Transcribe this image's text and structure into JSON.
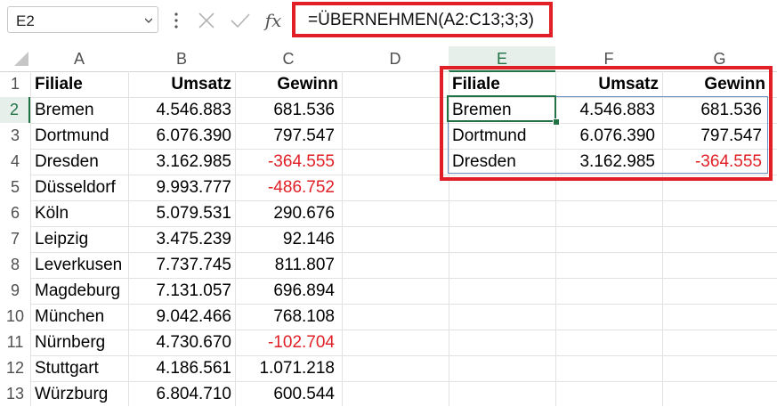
{
  "formula_bar": {
    "name_box": "E2",
    "fx_label": "fx",
    "formula": "=ÜBERNEHMEN(A2:C13;3;3)"
  },
  "columns": [
    "A",
    "B",
    "C",
    "D",
    "E",
    "F",
    "G"
  ],
  "rows": [
    "1",
    "2",
    "3",
    "4",
    "5",
    "6",
    "7",
    "8",
    "9",
    "10",
    "11",
    "12",
    "13"
  ],
  "source_table": {
    "headers": [
      "Filiale",
      "Umsatz",
      "Gewinn"
    ],
    "data": [
      [
        "Bremen",
        "4.546.883",
        "681.536"
      ],
      [
        "Dortmund",
        "6.076.390",
        "797.547"
      ],
      [
        "Dresden",
        "3.162.985",
        "-364.555"
      ],
      [
        "Düsseldorf",
        "9.993.777",
        "-486.752"
      ],
      [
        "Köln",
        "5.079.531",
        "290.676"
      ],
      [
        "Leipzig",
        "3.475.239",
        "92.146"
      ],
      [
        "Leverkusen",
        "7.737.745",
        "811.807"
      ],
      [
        "Magdeburg",
        "7.131.057",
        "696.894"
      ],
      [
        "München",
        "9.042.466",
        "768.108"
      ],
      [
        "Nürnberg",
        "4.730.670",
        "-102.704"
      ],
      [
        "Stuttgart",
        "4.186.561",
        "1.071.218"
      ],
      [
        "Würzburg",
        "6.804.710",
        "600.544"
      ]
    ]
  },
  "result_table": {
    "headers": [
      "Filiale",
      "Umsatz",
      "Gewinn"
    ],
    "data": [
      [
        "Bremen",
        "4.546.883",
        "681.536"
      ],
      [
        "Dortmund",
        "6.076.390",
        "797.547"
      ],
      [
        "Dresden",
        "3.162.985",
        "-364.555"
      ]
    ]
  },
  "colors": {
    "highlight_red": "#e01f26",
    "negative_text": "#e01f26",
    "selection_green": "#217346"
  }
}
